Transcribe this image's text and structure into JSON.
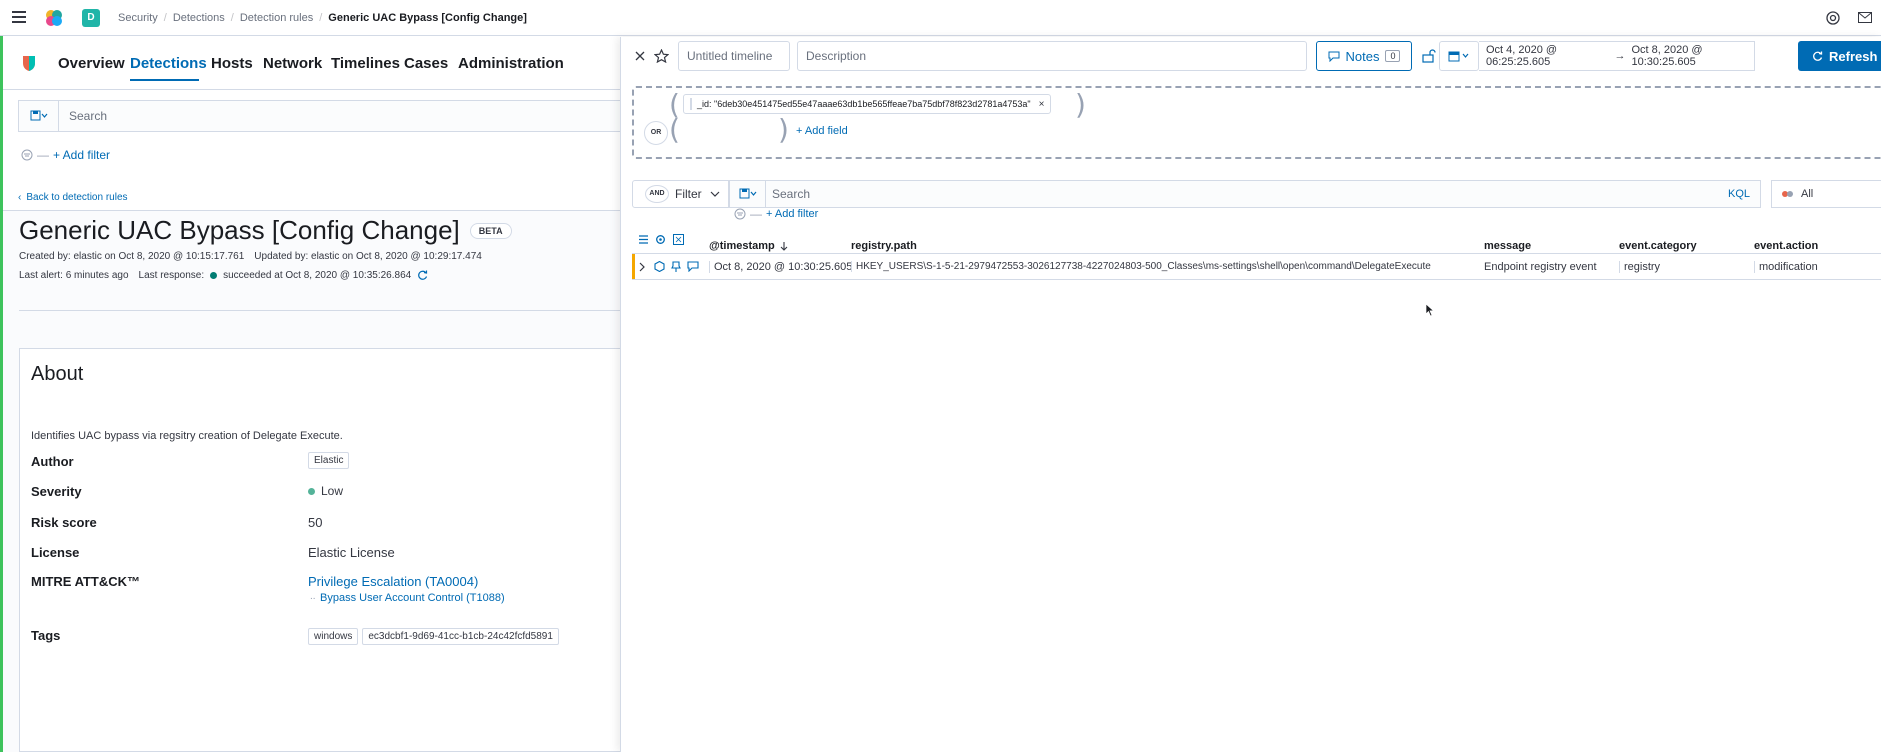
{
  "header": {
    "space_letter": "D",
    "breadcrumbs": [
      "Security",
      "Detections",
      "Detection rules",
      "Generic UAC Bypass [Config Change]"
    ]
  },
  "nav": {
    "tabs": [
      "Overview",
      "Detections",
      "Hosts",
      "Network",
      "Timelines",
      "Cases",
      "Administration"
    ],
    "active_tab": "Detections"
  },
  "left_search": {
    "placeholder": "Search",
    "add_filter": "+ Add filter"
  },
  "rule": {
    "back_link": "Back to detection rules",
    "title": "Generic UAC Bypass [Config Change]",
    "beta_badge": "BETA",
    "created_line": "Created by: elastic on Oct 8, 2020 @ 10:15:17.761",
    "updated_line": "Updated by: elastic on Oct 8, 2020 @ 10:29:17.474",
    "last_alert": "Last alert: 6 minutes ago",
    "last_response_label": "Last response:",
    "last_response_value": "succeeded at Oct 8, 2020 @ 10:35:26.864"
  },
  "about": {
    "heading": "About",
    "description": "Identifies UAC bypass via regsitry creation of Delegate Execute.",
    "author_label": "Author",
    "author_value": "Elastic",
    "severity_label": "Severity",
    "severity_value": "Low",
    "risk_label": "Risk score",
    "risk_value": "50",
    "license_label": "License",
    "license_value": "Elastic License",
    "mitre_label": "MITRE ATT&CK™",
    "mitre_tactic": "Privilege Escalation (TA0004)",
    "mitre_technique": "Bypass User Account Control (T1088)",
    "tags_label": "Tags",
    "tags": [
      "windows",
      "ec3dcbf1-9d69-41cc-b1cb-24c42fcfd5891"
    ]
  },
  "timeline": {
    "title_placeholder": "Untitled timeline",
    "description_placeholder": "Description",
    "notes_label": "Notes",
    "notes_count": "0",
    "date_start": "Oct 4, 2020 @ 06:25:25.605",
    "date_arrow": "→",
    "date_end": "Oct 8, 2020 @ 10:30:25.605",
    "refresh_label": "Refresh",
    "query_pill": "_id: \"6deb30e451475ed55e47aaae63db1be565ffeae7ba75dbf78f823d2781a4753a\"",
    "or_label": "OR",
    "add_field": "+ Add field",
    "and_label": "AND",
    "filter_label": "Filter",
    "search_placeholder": "Search",
    "kql_label": "KQL",
    "all_label": "All",
    "add_filter": "+ Add filter",
    "columns": [
      "@timestamp",
      "registry.path",
      "message",
      "event.category",
      "event.action"
    ],
    "rows": [
      {
        "timestamp": "Oct 8, 2020 @ 10:30:25.605",
        "registry_path": "HKEY_USERS\\S-1-5-21-2979472553-3026127738-4227024803-500_Classes\\ms-settings\\shell\\open\\command\\DelegateExecute",
        "message": "Endpoint registry event",
        "event_category": "registry",
        "event_action": "modification"
      }
    ]
  },
  "colors": {
    "accent": "#006bb4",
    "refresh_bg": "#006bb4",
    "success": "#017d73",
    "severity_low": "#54b399",
    "edge_green": "#3ec35c"
  }
}
